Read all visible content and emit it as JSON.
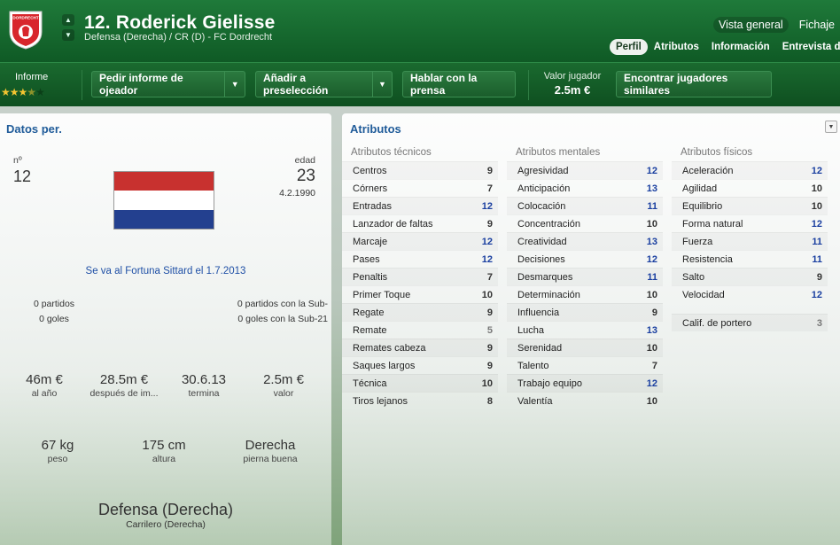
{
  "header": {
    "player_name": "12. Roderick Gielisse",
    "subtitle": "Defensa (Derecha) / CR (D) - FC Dordrecht",
    "crest_text": "DORDRECHT",
    "top_links": [
      "Vista general",
      "Fichaje"
    ],
    "tabs": [
      "Perfil",
      "Atributos",
      "Información",
      "Entrevista de"
    ]
  },
  "toolbar": {
    "informe_label": "Informe",
    "stars": 3.5,
    "buttons": {
      "pedir": "Pedir informe de ojeador",
      "anadir": "Añadir a preselección",
      "hablar": "Hablar con la prensa",
      "encontrar": "Encontrar jugadores similares"
    },
    "valor_label": "Valor jugador",
    "valor_value": "2.5m €"
  },
  "left": {
    "title": "Datos per.",
    "dorsal_label": "nº",
    "dorsal_value": "12",
    "edad_label": "edad",
    "edad_value": "23",
    "birthdate": "4.2.1990",
    "transfer_note": "Se va al Fortuna Sittard el 1.7.2013",
    "partidos": "0 partidos",
    "goles": "0 goles",
    "partidos_sub": "0 partidos con la Sub-",
    "goles_sub": "0 goles con la Sub-21",
    "stats": [
      {
        "v": "46m €",
        "k": "al año"
      },
      {
        "v": "28.5m €",
        "k": "después de im..."
      },
      {
        "v": "30.6.13",
        "k": "termina"
      },
      {
        "v": "2.5m €",
        "k": "valor"
      }
    ],
    "physical": [
      {
        "v": "67 kg",
        "k": "peso"
      },
      {
        "v": "175 cm",
        "k": "altura"
      },
      {
        "v": "Derecha",
        "k": "pierna buena"
      }
    ],
    "position_main": "Defensa (Derecha)",
    "position_role": "Carrilero (Derecha)"
  },
  "attributes": {
    "title": "Atributos",
    "columns": [
      {
        "heading": "Atributos técnicos",
        "rows": [
          {
            "label": "Centros",
            "value": 9
          },
          {
            "label": "Córners",
            "value": 7
          },
          {
            "label": "Entradas",
            "value": 12
          },
          {
            "label": "Lanzador de faltas",
            "value": 9
          },
          {
            "label": "Marcaje",
            "value": 12
          },
          {
            "label": "Pases",
            "value": 12
          },
          {
            "label": "Penaltis",
            "value": 7
          },
          {
            "label": "Primer Toque",
            "value": 10
          },
          {
            "label": "Regate",
            "value": 9
          },
          {
            "label": "Remate",
            "value": 5
          },
          {
            "label": "Remates cabeza",
            "value": 9
          },
          {
            "label": "Saques largos",
            "value": 9
          },
          {
            "label": "Técnica",
            "value": 10
          },
          {
            "label": "Tiros lejanos",
            "value": 8
          }
        ]
      },
      {
        "heading": "Atributos mentales",
        "rows": [
          {
            "label": "Agresividad",
            "value": 12
          },
          {
            "label": "Anticipación",
            "value": 13
          },
          {
            "label": "Colocación",
            "value": 11
          },
          {
            "label": "Concentración",
            "value": 10
          },
          {
            "label": "Creatividad",
            "value": 13
          },
          {
            "label": "Decisiones",
            "value": 12
          },
          {
            "label": "Desmarques",
            "value": 11
          },
          {
            "label": "Determinación",
            "value": 10
          },
          {
            "label": "Influencia",
            "value": 9
          },
          {
            "label": "Lucha",
            "value": 13
          },
          {
            "label": "Serenidad",
            "value": 10
          },
          {
            "label": "Talento",
            "value": 7
          },
          {
            "label": "Trabajo equipo",
            "value": 12
          },
          {
            "label": "Valentía",
            "value": 10
          }
        ]
      },
      {
        "heading": "Atributos físicos",
        "rows": [
          {
            "label": "Aceleración",
            "value": 12
          },
          {
            "label": "Agilidad",
            "value": 10
          },
          {
            "label": "Equilibrio",
            "value": 10
          },
          {
            "label": "Forma natural",
            "value": 12
          },
          {
            "label": "Fuerza",
            "value": 11
          },
          {
            "label": "Resistencia",
            "value": 11
          },
          {
            "label": "Salto",
            "value": 9
          },
          {
            "label": "Velocidad",
            "value": 12
          }
        ],
        "extra": {
          "label": "Calif. de portero",
          "value": 3
        }
      }
    ]
  },
  "colors": {
    "header_green": "#1f7a3a",
    "title_blue": "#1f5b99",
    "high_value_blue": "#1a3fa0",
    "star_gold": "#f3c431"
  }
}
